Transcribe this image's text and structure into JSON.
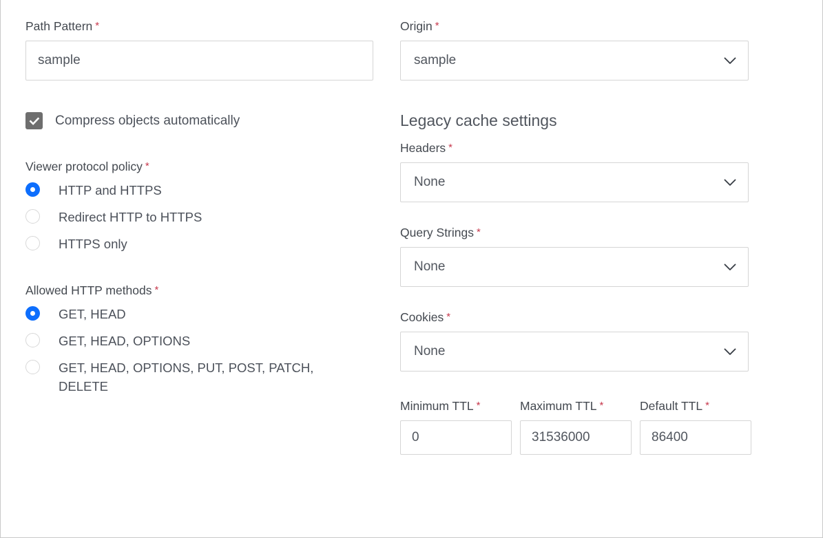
{
  "left": {
    "path_pattern": {
      "label": "Path Pattern",
      "required_mark": "*",
      "value": "sample",
      "placeholder": "Path Pattern"
    },
    "compress": {
      "label": "Compress objects automatically",
      "checked": true,
      "icon": "check-icon"
    },
    "viewer_protocol_policy": {
      "label": "Viewer protocol policy",
      "required_mark": "*",
      "selected": "HTTP and HTTPS",
      "options": [
        "HTTP and HTTPS",
        "Redirect HTTP to HTTPS",
        "HTTPS only"
      ]
    },
    "allowed_http_methods": {
      "label": "Allowed HTTP methods",
      "required_mark": "*",
      "selected": "GET, HEAD",
      "options": [
        "GET, HEAD",
        "GET, HEAD, OPTIONS",
        "GET, HEAD, OPTIONS, PUT, POST, PATCH, DELETE"
      ]
    }
  },
  "right": {
    "origin": {
      "label": "Origin",
      "required_mark": "*",
      "value": "sample",
      "chevron_icon": "chevron-down-icon"
    },
    "legacy_cache_settings": {
      "heading": "Legacy cache settings",
      "headers": {
        "label": "Headers",
        "required_mark": "*",
        "value": "None",
        "chevron_icon": "chevron-down-icon"
      },
      "query_strings": {
        "label": "Query Strings",
        "required_mark": "*",
        "value": "None",
        "chevron_icon": "chevron-down-icon"
      },
      "cookies": {
        "label": "Cookies",
        "required_mark": "*",
        "value": "None",
        "chevron_icon": "chevron-down-icon"
      },
      "ttl": [
        {
          "label": "Minimum TTL",
          "required_mark": "*",
          "value": "0"
        },
        {
          "label": "Maximum TTL",
          "required_mark": "*",
          "value": "31536000"
        },
        {
          "label": "Default TTL",
          "required_mark": "*",
          "value": "86400"
        }
      ]
    }
  },
  "colors": {
    "required_star": "#c73a4e",
    "radio_selected": "#0d6efd",
    "checkbox_fill": "#6e6e6e",
    "label_text": "#444950",
    "value_text": "#51565e",
    "border": "#d5d5d5"
  }
}
